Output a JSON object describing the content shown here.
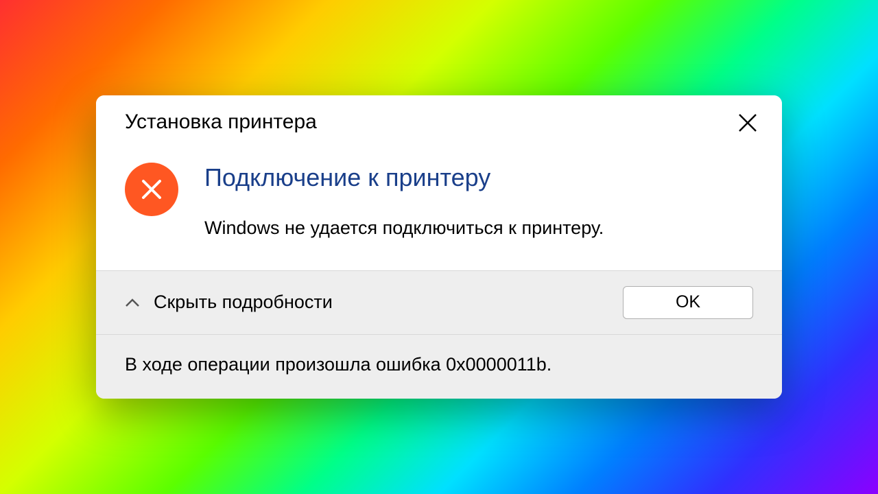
{
  "dialog": {
    "title": "Установка принтера",
    "heading": "Подключение к принтеру",
    "message": "Windows не удается подключиться к принтеру.",
    "details_toggle_label": "Скрыть подробности",
    "ok_label": "OK",
    "details_text": "В ходе операции произошла ошибка 0x0000011b.",
    "colors": {
      "error_icon_bg": "#ff5722",
      "heading_color": "#1a3f8a"
    }
  }
}
